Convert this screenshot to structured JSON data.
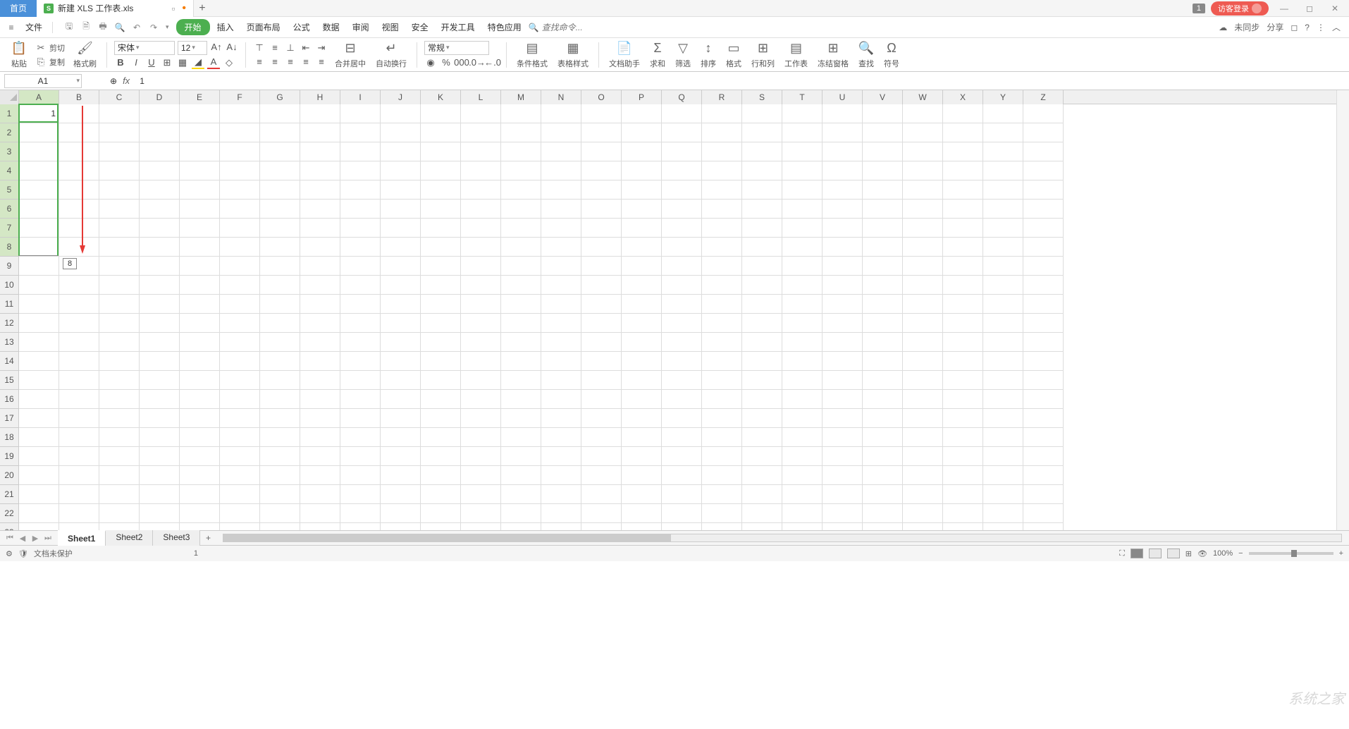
{
  "titlebar": {
    "home_tab": "首页",
    "doc_icon": "S",
    "doc_name": "新建 XLS 工作表.xls",
    "badge": "1",
    "login": "访客登录"
  },
  "menubar": {
    "file": "文件",
    "items": [
      "开始",
      "插入",
      "页面布局",
      "公式",
      "数据",
      "审阅",
      "视图",
      "安全",
      "开发工具",
      "特色应用"
    ],
    "search_placeholder": "查找命令...",
    "sync": "未同步",
    "share": "分享"
  },
  "ribbon": {
    "paste": "粘贴",
    "cut": "剪切",
    "copy": "复制",
    "format_painter": "格式刷",
    "font_name": "宋体",
    "font_size": "12",
    "number_format": "常规",
    "merge_center": "合并居中",
    "auto_wrap": "自动换行",
    "cond_format": "条件格式",
    "table_style": "表格样式",
    "doc_helper": "文档助手",
    "sum": "求和",
    "filter": "筛选",
    "sort": "排序",
    "format": "格式",
    "row_col": "行和列",
    "worksheet": "工作表",
    "freeze": "冻结窗格",
    "find": "查找",
    "symbol": "符号"
  },
  "formula": {
    "name_box": "A1",
    "fx": "fx",
    "value": "1"
  },
  "grid": {
    "columns": [
      "A",
      "B",
      "C",
      "D",
      "E",
      "F",
      "G",
      "H",
      "I",
      "J",
      "K",
      "L",
      "M",
      "N",
      "O",
      "P",
      "Q",
      "R",
      "S",
      "T",
      "U",
      "V",
      "W",
      "X",
      "Y",
      "Z"
    ],
    "row_count": 23,
    "cell_a1": "1",
    "drag_tooltip": "8"
  },
  "sheets": {
    "tabs": [
      "Sheet1",
      "Sheet2",
      "Sheet3"
    ],
    "active": 0
  },
  "status": {
    "protect": "文档未保护",
    "count": "1",
    "zoom": "100%"
  },
  "watermark": "系统之家"
}
